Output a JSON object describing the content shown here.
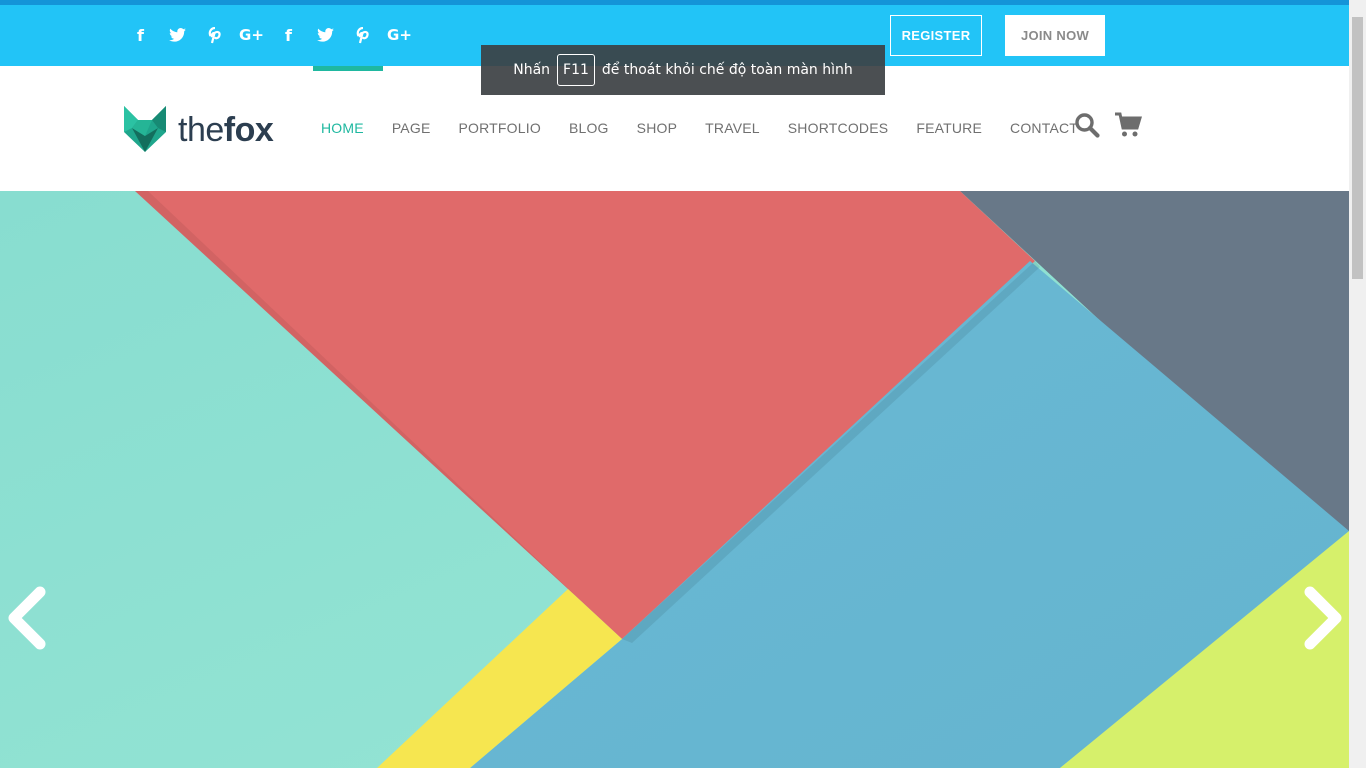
{
  "topbar": {
    "social_icons": [
      {
        "name": "facebook-icon",
        "glyph": "f"
      },
      {
        "name": "twitter-icon",
        "glyph": "t"
      },
      {
        "name": "pinterest-icon",
        "glyph": "p"
      },
      {
        "name": "google-plus-icon",
        "glyph": "G+"
      },
      {
        "name": "facebook-icon",
        "glyph": "f"
      },
      {
        "name": "twitter-icon",
        "glyph": "t"
      },
      {
        "name": "pinterest-icon",
        "glyph": "p"
      },
      {
        "name": "google-plus-icon",
        "glyph": "G+"
      }
    ],
    "register_label": "REGISTER",
    "join_label": "JOIN NOW",
    "bg_color": "#22c4f7"
  },
  "header": {
    "logo_light": "the",
    "logo_bold": "fox",
    "nav": [
      "HOME",
      "PAGE",
      "PORTFOLIO",
      "BLOG",
      "SHOP",
      "TRAVEL",
      "SHORTCODES",
      "FEATURE",
      "CONTACT"
    ],
    "active_item": "HOME",
    "accent_color": "#1fb8a0"
  },
  "toast": {
    "prefix": "Nhấn",
    "key": "F11",
    "suffix": "để thoát khỏi chế độ toàn màn hình"
  },
  "hero": {
    "colors": [
      "#8ee0d0",
      "#e06a6a",
      "#687888",
      "#68b8d2",
      "#f7e650",
      "#d5f06a"
    ],
    "prev_icon": "chevron-left-icon",
    "next_icon": "chevron-right-icon"
  }
}
